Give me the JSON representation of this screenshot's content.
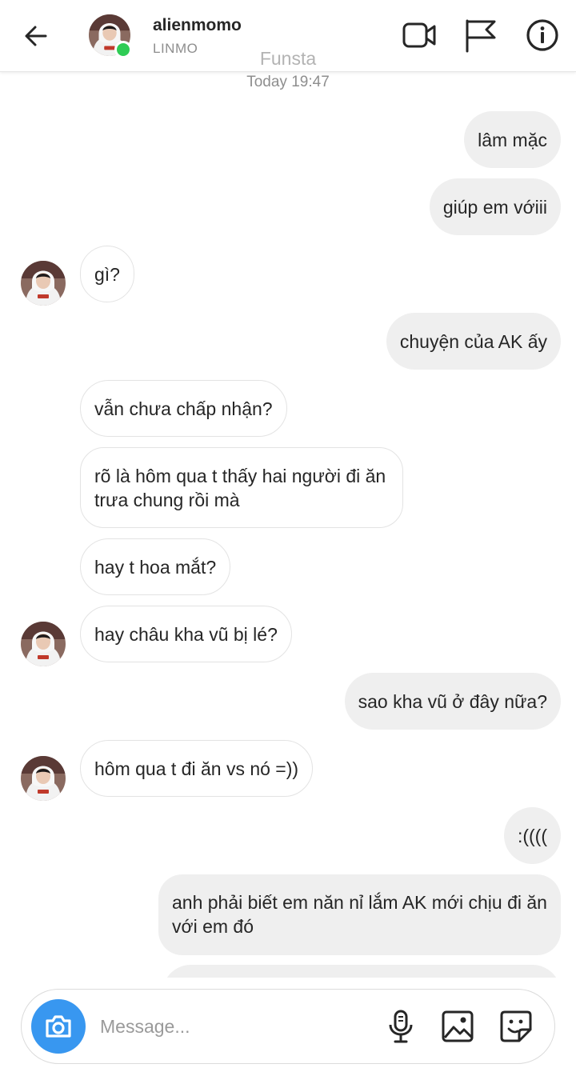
{
  "header": {
    "username": "alienmomo",
    "subtitle": "LINMO",
    "overlay_label": "Funsta",
    "icons": [
      "back-arrow-icon",
      "video-call-icon",
      "flag-icon",
      "info-icon"
    ]
  },
  "thread": {
    "timestamp": "Today 19:47",
    "messages": [
      {
        "from": "me",
        "text": "lâm mặc"
      },
      {
        "from": "me",
        "text": "giúp em vớiii"
      },
      {
        "from": "them",
        "text": "gì?"
      },
      {
        "from": "me",
        "text": "chuyện của AK ấy"
      },
      {
        "from": "them",
        "text": "vẫn chưa chấp nhận?"
      },
      {
        "from": "them",
        "text": "rõ là hôm qua t thấy hai người đi ăn trưa chung rồi mà"
      },
      {
        "from": "them",
        "text": "hay t hoa mắt?"
      },
      {
        "from": "them",
        "text": "hay châu kha vũ bị lé?"
      },
      {
        "from": "me",
        "text": "sao kha vũ ở đây nữa?"
      },
      {
        "from": "them",
        "text": "hôm qua t đi ăn vs nó =))"
      },
      {
        "from": "me",
        "text": ":(((("
      },
      {
        "from": "me",
        "text": "anh phải biết em năn nỉ lắm AK mới chịu đi ăn với em đó"
      }
    ]
  },
  "composer": {
    "placeholder": "Message...",
    "icons": [
      "camera-icon",
      "microphone-icon",
      "gallery-icon",
      "sticker-icon"
    ]
  },
  "colors": {
    "accent": "#3897f0",
    "online": "#2fcc55",
    "outgoing_bubble": "#efefef",
    "incoming_border": "#e3e3e3"
  }
}
